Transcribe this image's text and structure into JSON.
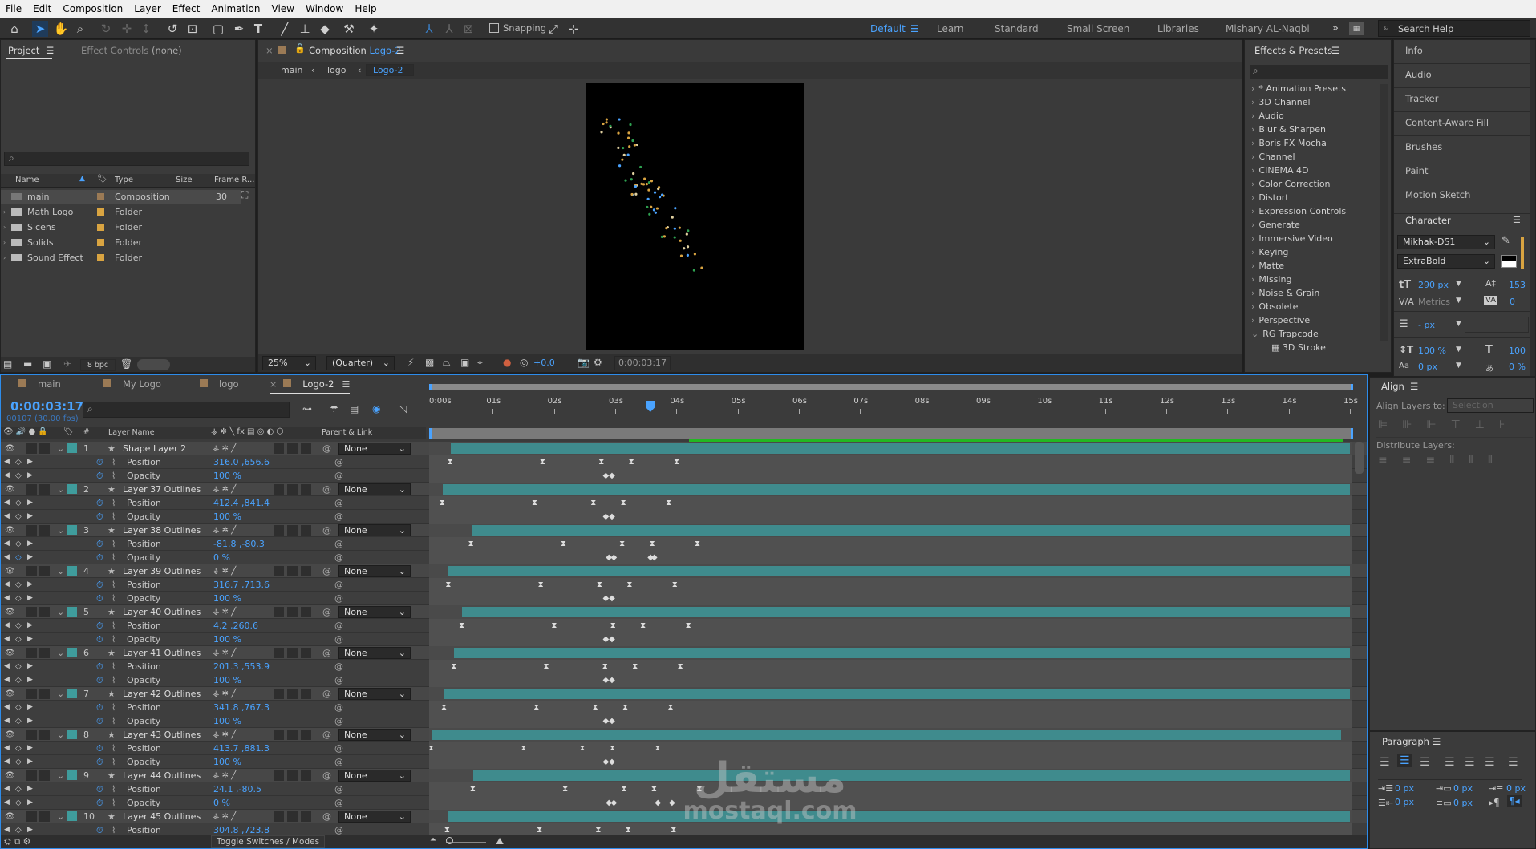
{
  "menu": [
    "File",
    "Edit",
    "Composition",
    "Layer",
    "Effect",
    "Animation",
    "View",
    "Window",
    "Help"
  ],
  "toolbar": {
    "snapping_label": "Snapping",
    "workspaces": [
      {
        "label": "Default",
        "active": true
      },
      {
        "label": "Learn"
      },
      {
        "label": "Standard"
      },
      {
        "label": "Small Screen"
      },
      {
        "label": "Libraries"
      },
      {
        "label": "Mishary AL-Naqbi"
      }
    ],
    "search_help_placeholder": "Search Help"
  },
  "project": {
    "tab_project": "Project",
    "tab_effect_controls": "Effect Controls",
    "effect_controls_target": "(none)",
    "columns": [
      "Name",
      "Type",
      "Size",
      "Frame R..."
    ],
    "items": [
      {
        "name": "main",
        "type": "Composition",
        "size": "",
        "frame_rate": "30"
      },
      {
        "name": "Math Logo",
        "type": "Folder",
        "size": "",
        "frame_rate": ""
      },
      {
        "name": "Sicens",
        "type": "Folder",
        "size": "",
        "frame_rate": ""
      },
      {
        "name": "Solids",
        "type": "Folder",
        "size": "",
        "frame_rate": ""
      },
      {
        "name": "Sound Effect",
        "type": "Folder",
        "size": "",
        "frame_rate": ""
      }
    ],
    "bpc": "8 bpc"
  },
  "composition": {
    "tab_prefix": "Composition",
    "tab_name": "Logo-2",
    "breadcrumbs": [
      "main",
      "logo",
      "Logo-2"
    ],
    "zoom": "25%",
    "resolution": "(Quarter)",
    "exposure": "+0.0",
    "timecode": "0:00:03:17"
  },
  "effects": {
    "title": "Effects & Presets",
    "items": [
      "* Animation Presets",
      "3D Channel",
      "Audio",
      "Blur & Sharpen",
      "Boris FX Mocha",
      "Channel",
      "CINEMA 4D",
      "Color Correction",
      "Distort",
      "Expression Controls",
      "Generate",
      "Immersive Video",
      "Keying",
      "Matte",
      "Missing",
      "Noise & Grain",
      "Obsolete",
      "Perspective",
      "RG Trapcode"
    ],
    "expanded_child": "3D Stroke"
  },
  "right_panels": [
    "Info",
    "Audio",
    "Tracker",
    "Content-Aware Fill",
    "Brushes",
    "Paint",
    "Motion Sketch"
  ],
  "character": {
    "title": "Character",
    "font": "Mikhak-DS1",
    "style": "ExtraBold",
    "size": "290 px",
    "leading": "153",
    "kerning": "Metrics",
    "tracking": "0",
    "stroke": "- px",
    "vscale": "100 %",
    "hscale": "100",
    "baseline": "0 px",
    "tsume": "0 %"
  },
  "align": {
    "title": "Align",
    "align_to_label": "Align Layers to:",
    "align_to_value": "Selection",
    "distribute_label": "Distribute Layers:"
  },
  "paragraph": {
    "title": "Paragraph",
    "indent_left": "0 px",
    "indent_first": "0 px",
    "space_before": "0 px",
    "indent_right": "0 px",
    "space_after": "0 px"
  },
  "timeline": {
    "tabs": [
      "main",
      "My Logo",
      "logo",
      "Logo-2"
    ],
    "active_tab": "Logo-2",
    "current_time": "0:00:03:17",
    "frame_info": "00107 (30.00 fps)",
    "current_seconds": 3.567,
    "duration_seconds": 15,
    "ruler": [
      "0:00s",
      "01s",
      "02s",
      "03s",
      "04s",
      "05s",
      "06s",
      "07s",
      "08s",
      "09s",
      "10s",
      "11s",
      "12s",
      "13s",
      "14s",
      "15s"
    ],
    "headers": {
      "number": "#",
      "layer_name": "Layer Name",
      "parent": "Parent & Link"
    },
    "position_label": "Position",
    "opacity_label": "Opacity",
    "parent_value": "None",
    "toggle_label": "Toggle Switches / Modes",
    "bar_color": "#3f8b8d",
    "layers": [
      {
        "num": "1",
        "name": "Shape Layer 2",
        "position": "316.0 ,656.6",
        "opacity": "100 %",
        "start": 0.31,
        "end": 15,
        "pos_keys": [
          0.31,
          1.82,
          2.78,
          3.27,
          4.01
        ],
        "op_keys": [
          2.85,
          2.95
        ]
      },
      {
        "num": "2",
        "name": "Layer 37 Outlines",
        "position": "412.4 ,841.4",
        "opacity": "100 %",
        "start": 0.18,
        "end": 15,
        "pos_keys": [
          0.18,
          1.69,
          2.65,
          3.14,
          3.88
        ],
        "op_keys": [
          2.85,
          2.95
        ]
      },
      {
        "num": "3",
        "name": "Layer 38 Outlines",
        "position": "-81.8 ,-80.3",
        "opacity": "0 %",
        "start": 0.65,
        "end": 15,
        "pos_keys": [
          0.65,
          2.16,
          3.12,
          3.61,
          4.35
        ],
        "op_keys": [
          2.9,
          2.98,
          3.58,
          3.64
        ]
      },
      {
        "num": "4",
        "name": "Layer 39 Outlines",
        "position": "316.7 ,713.6",
        "opacity": "100 %",
        "start": 0.28,
        "end": 15,
        "pos_keys": [
          0.28,
          1.79,
          2.75,
          3.24,
          3.98
        ],
        "op_keys": [
          2.85,
          2.95
        ]
      },
      {
        "num": "5",
        "name": "Layer 40 Outlines",
        "position": "4.2 ,260.6",
        "opacity": "100 %",
        "start": 0.5,
        "end": 15,
        "pos_keys": [
          0.5,
          2.01,
          2.97,
          3.46,
          4.2
        ],
        "op_keys": [
          2.85,
          2.95
        ]
      },
      {
        "num": "6",
        "name": "Layer 41 Outlines",
        "position": "201.3 ,553.9",
        "opacity": "100 %",
        "start": 0.37,
        "end": 15,
        "pos_keys": [
          0.37,
          1.88,
          2.84,
          3.33,
          4.07
        ],
        "op_keys": [
          2.85,
          2.95
        ]
      },
      {
        "num": "7",
        "name": "Layer 42 Outlines",
        "position": "341.8 ,767.3",
        "opacity": "100 %",
        "start": 0.21,
        "end": 15,
        "pos_keys": [
          0.21,
          1.72,
          2.68,
          3.17,
          3.91
        ],
        "op_keys": [
          2.85,
          2.95
        ]
      },
      {
        "num": "8",
        "name": "Layer 43 Outlines",
        "position": "413.7 ,881.3",
        "opacity": "100 %",
        "start": 0.0,
        "end": 14.85,
        "pos_keys": [
          0.0,
          1.51,
          2.47,
          2.96,
          3.7
        ],
        "op_keys": [
          2.85,
          2.95
        ]
      },
      {
        "num": "9",
        "name": "Layer 44 Outlines",
        "position": "24.1 ,-80.5",
        "opacity": "0 %",
        "start": 0.68,
        "end": 15,
        "pos_keys": [
          0.68,
          2.19,
          3.15,
          3.64,
          4.38
        ],
        "op_keys": [
          2.9,
          2.98,
          3.7,
          3.93
        ]
      },
      {
        "num": "10",
        "name": "Layer 45 Outlines",
        "position": "304.8 ,723.8",
        "opacity": "100 %",
        "start": 0.26,
        "end": 15,
        "pos_keys": [
          0.26,
          1.77,
          2.73,
          3.22,
          3.96
        ],
        "op_keys": [
          2.85,
          2.95
        ]
      }
    ]
  },
  "watermark": {
    "arabic": "مستقل",
    "latin": "mostaql.com"
  },
  "colors": {
    "accent": "#4aa3ff",
    "panel": "#3b3b3b",
    "layer_label": "#3f9c9c",
    "folder": "#d9a441",
    "work_area": "#22b822"
  }
}
